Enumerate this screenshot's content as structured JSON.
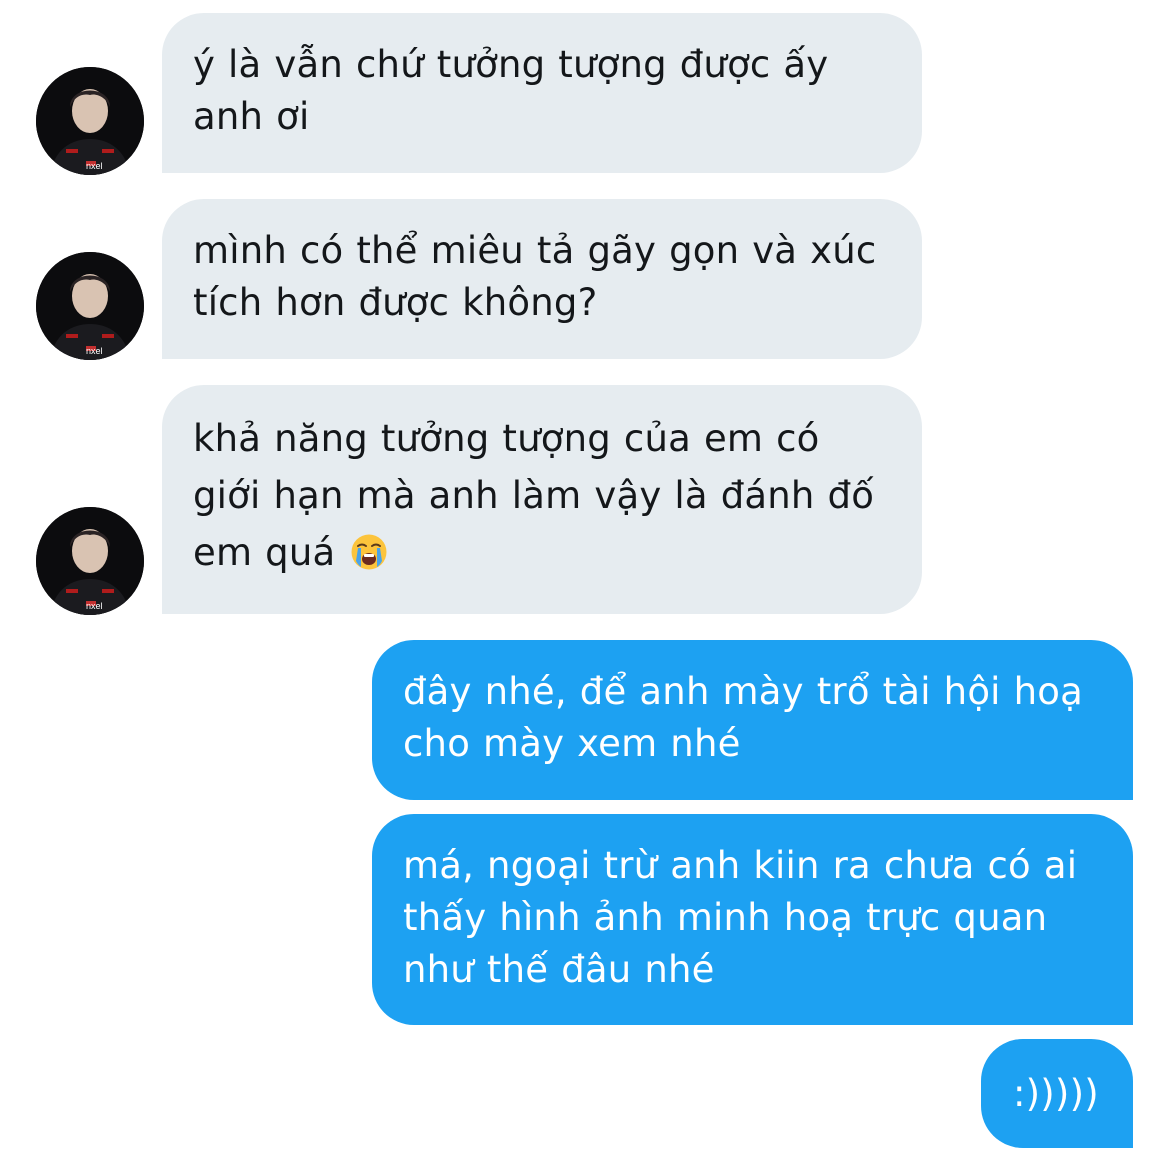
{
  "conversation": {
    "colors": {
      "incoming_bubble": "#e6ecf0",
      "incoming_text": "#14171a",
      "outgoing_bubble": "#1da1f2",
      "outgoing_text": "#ffffff"
    },
    "avatar": {
      "shirt_text": "nxel"
    },
    "messages": [
      {
        "direction": "incoming",
        "text": "ý là vẫn chứ tưởng tượng được ấy anh ơi"
      },
      {
        "direction": "incoming",
        "text": "mình có thể miêu tả gãy gọn và xúc tích hơn được không?"
      },
      {
        "direction": "incoming",
        "text": "khả năng tưởng tượng của em có giới hạn mà anh làm vậy là đánh đố em quá",
        "emoji": "loudly-crying-face"
      },
      {
        "direction": "outgoing",
        "text": "đây nhé, để anh mày trổ tài hội hoạ cho mày xem nhé"
      },
      {
        "direction": "outgoing",
        "text": "má, ngoại trừ anh kiin ra chưa có ai thấy hình ảnh minh hoạ trực quan như thế đâu nhé"
      },
      {
        "direction": "outgoing",
        "text": ":)))))"
      }
    ]
  }
}
